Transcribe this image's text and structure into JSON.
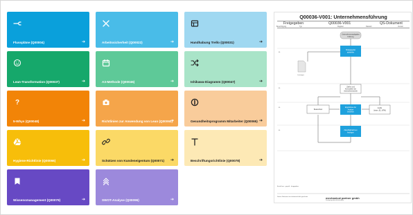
{
  "tiles": [
    {
      "label": "Flusspläne (Q00004)",
      "icon": "shuffle-icon",
      "color": "#0aa0db",
      "dark": false
    },
    {
      "label": "Arbeitssicherheit (Q00022)",
      "icon": "close-icon",
      "color": "#49bce8",
      "dark": false
    },
    {
      "label": "Handhabung Trello (Q00031)",
      "icon": "board-icon",
      "color": "#9fd8f1",
      "dark": true
    },
    {
      "label": "Lean-Transformation (Q00037)",
      "icon": "smile-icon",
      "color": "#16a86b",
      "dark": false
    },
    {
      "label": "A3-Methode (Q00046)",
      "icon": "calendar-icon",
      "color": "#5ec998",
      "dark": false
    },
    {
      "label": "Ishikawa-Diagramm (Q00047)",
      "icon": "shuffle-cross-icon",
      "color": "#a9e4c8",
      "dark": true
    },
    {
      "label": "5-Whys (Q00048)",
      "icon": "question-icon",
      "color": "#f28407",
      "dark": false
    },
    {
      "label": "Richtlinien zur Anwendung von Lean (Q00060)",
      "icon": "camera-icon",
      "color": "#f5a54a",
      "dark": false
    },
    {
      "label": "Gesundheitsprogramm Mitarbeiter (Q00065)",
      "icon": "target-icon",
      "color": "#f9cc9b",
      "dark": true
    },
    {
      "label": "Hygiene-Richtlinie (Q00066)",
      "icon": "drive-icon",
      "color": "#f7be0a",
      "dark": false
    },
    {
      "label": "Schützen von Kundeneigentum (Q00071)",
      "icon": "link-icon",
      "color": "#fbd966",
      "dark": true
    },
    {
      "label": "Beschriftungsrichtlinie (Q00078)",
      "icon": "text-icon",
      "color": "#fde9b5",
      "dark": true
    },
    {
      "label": "Wissensmanagement (Q00079)",
      "icon": "map-icon",
      "color": "#6749c4",
      "dark": false
    },
    {
      "label": "SWOT-Analyse (Q00096)",
      "icon": "chevrons-up-icon",
      "color": "#9c89dc",
      "dark": false
    }
  ],
  "tile_arrow": "➔",
  "document": {
    "title": "Q00036-V001: Unternehmensführung",
    "status": "Freigegeben",
    "code": "Q00036-V001",
    "type": "QS-Dokument",
    "meta": [
      "Berechtigung",
      "Typ",
      "Register",
      "Dateiart",
      "Version"
    ],
    "company": "mechanical partner gmbh",
    "company_sub": "Fertigungsdienstleistungen"
  },
  "colors": {
    "flow_blue": "#1ea1dd",
    "flow_grey": "#d9d9d9"
  }
}
